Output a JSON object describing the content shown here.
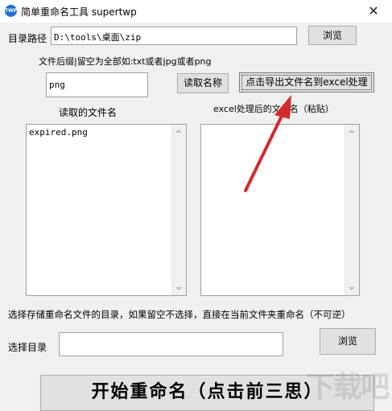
{
  "window": {
    "icon_text": "TWP",
    "title": "简单重命名工具 supertwp",
    "close_glyph": "✕"
  },
  "dir_row": {
    "label": "目录路径",
    "value": "D:\\tools\\桌面\\zip",
    "browse_label": "浏览"
  },
  "suffix_row": {
    "hint": "文件后缀|留空为全部如:txt或者jpg或者png",
    "value": "png",
    "read_button": "读取名称",
    "export_button": "点击导出文件名到excel处理"
  },
  "read_panel": {
    "label": "读取的文件名",
    "items": [
      "expired.png"
    ]
  },
  "excel_panel": {
    "label": "excel处理后的文件名（粘贴）",
    "content": ""
  },
  "target_row": {
    "hint": "选择存储重命名文件的目录，如果留空不选择，直接在当前文件夹重命名（不可逆）",
    "label": "选择目录",
    "value": "",
    "browse_label": "浏览"
  },
  "start_button": "开始重命名（点击前三思）",
  "annotation_arrow": {
    "color": "#d42a2a"
  },
  "watermark": {
    "text": "下载吧"
  }
}
